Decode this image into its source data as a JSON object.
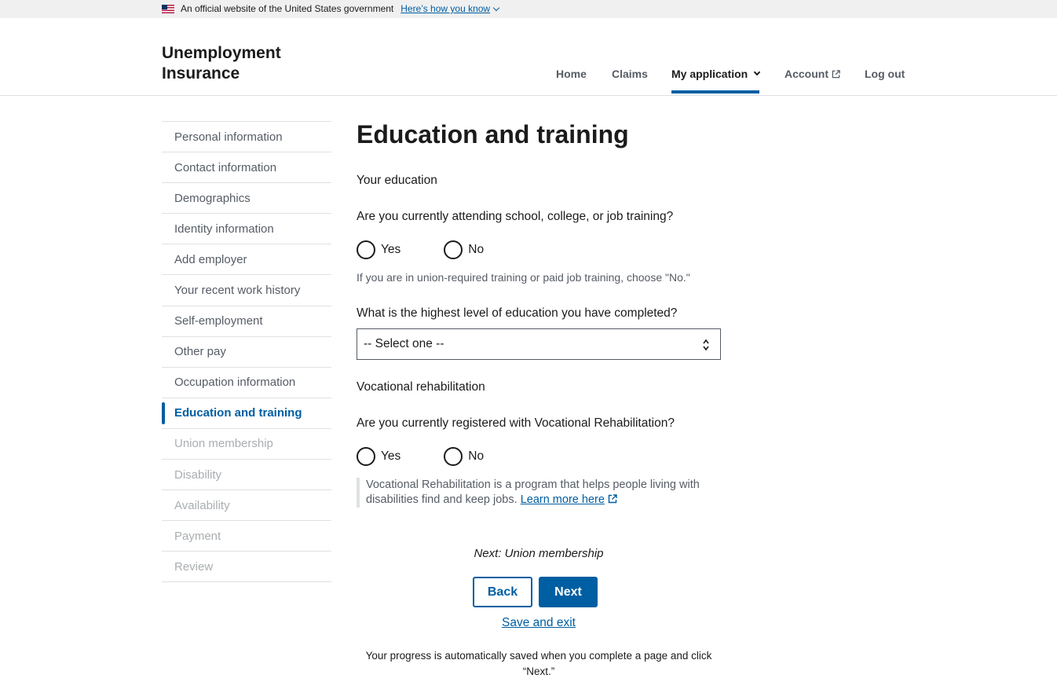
{
  "banner": {
    "text": "An official website of the United States government",
    "link": "Here’s how you know"
  },
  "header": {
    "logo_line1": "Unemployment",
    "logo_line2": "Insurance",
    "nav": {
      "home": "Home",
      "claims": "Claims",
      "my_application": "My application",
      "account": "Account",
      "logout": "Log out"
    }
  },
  "sidenav": {
    "items": [
      {
        "label": "Personal information",
        "state": "complete"
      },
      {
        "label": "Contact information",
        "state": "complete"
      },
      {
        "label": "Demographics",
        "state": "complete"
      },
      {
        "label": "Identity information",
        "state": "complete"
      },
      {
        "label": "Add employer",
        "state": "complete"
      },
      {
        "label": "Your recent work history",
        "state": "complete"
      },
      {
        "label": "Self-employment",
        "state": "complete"
      },
      {
        "label": "Other pay",
        "state": "complete"
      },
      {
        "label": "Occupation information",
        "state": "complete"
      },
      {
        "label": "Education and training",
        "state": "current"
      },
      {
        "label": "Union membership",
        "state": "disabled"
      },
      {
        "label": "Disability",
        "state": "disabled"
      },
      {
        "label": "Availability",
        "state": "disabled"
      },
      {
        "label": "Payment",
        "state": "disabled"
      },
      {
        "label": "Review",
        "state": "disabled"
      }
    ]
  },
  "main": {
    "title": "Education and training",
    "education_section": "Your education",
    "q_attending": "Are you currently attending school, college, or job training?",
    "yes": "Yes",
    "no": "No",
    "hint_attending": "If you are in union-required training or paid job training, choose \"No.\"",
    "q_education_level": "What is the highest level of education you have completed?",
    "select_value": "-- Select one --",
    "voc_section": "Vocational rehabilitation",
    "q_voc": "Are you currently registered with Vocational Rehabilitation?",
    "voc_note": "Vocational Rehabilitation is a program that helps people living with disabilities find and keep jobs.",
    "learn_more": "Learn more here"
  },
  "footer": {
    "next_hint": "Next: Union membership",
    "back": "Back",
    "next": "Next",
    "save_exit": "Save and exit",
    "progress_note_line1": "Your progress is automatically saved when you complete a page and click",
    "progress_note_line2": "“Next.”"
  },
  "colors": {
    "primary": "#005ea2",
    "text": "#1b1b1b",
    "muted": "#565c65",
    "disabled": "#a9aeb1",
    "border": "#dfe1e2"
  }
}
